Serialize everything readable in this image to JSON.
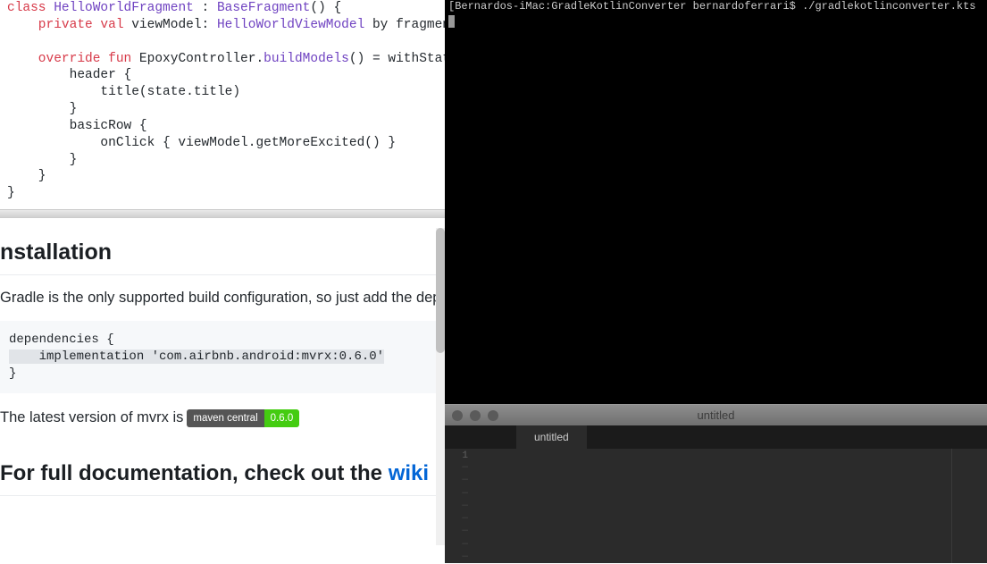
{
  "code": {
    "line1_class": "class",
    "line1_name": " HelloWorldFragment ",
    "line1_colon": ": ",
    "line1_base": "BaseFragment",
    "line1_end": "() {",
    "line2_priv": "    private",
    "line2_val": " val",
    "line2_vm": " viewModel",
    "line2_colon": ": ",
    "line2_type": "HelloWorldViewModel",
    "line2_end": " by fragment",
    "line4_ov": "    override",
    "line4_fun": " fun",
    "line4_ctrl": " EpoxyController.",
    "line4_bm": "buildModels",
    "line4_end": "() = withState",
    "line5": "        header {",
    "line6": "            title(state.title)",
    "line7": "        }",
    "line8": "        basicRow {",
    "line9": "            onClick { viewModel.getMoreExcited() }",
    "line10": "        }",
    "line11": "    }",
    "line12": "}"
  },
  "installation": {
    "heading": "nstallation",
    "body": "Gradle is the only supported build configuration, so just add the dep",
    "dep_open": "dependencies {",
    "dep_line": "    implementation 'com.airbnb.android:mvrx:0.6.0'",
    "dep_close": "}"
  },
  "badge": {
    "prefix": "The latest version of mvrx is ",
    "label": "maven central",
    "version": "0.6.0"
  },
  "docs": {
    "prefix": "For full documentation, check out the ",
    "link": "wiki"
  },
  "terminal": {
    "prompt": "[Bernardos-iMac:GradleKotlinConverter bernardoferrari$ ./gradlekotlinconverter.kts"
  },
  "editor": {
    "title": "untitled",
    "tab": "untitled",
    "line_no": "1"
  }
}
